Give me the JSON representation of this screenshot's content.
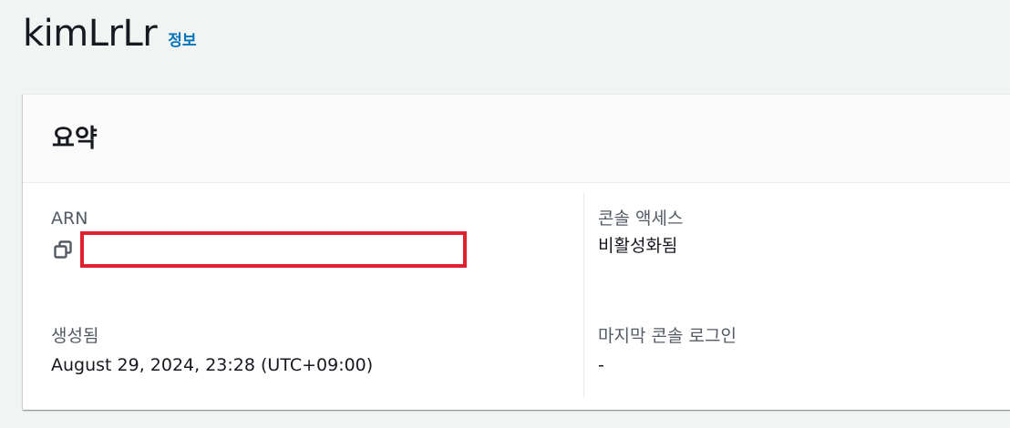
{
  "header": {
    "title": "kimLrLr",
    "info_link": "정보"
  },
  "summary": {
    "title": "요약",
    "arn": {
      "label": "ARN",
      "value": "",
      "copy_icon": "copy-icon",
      "redacted": true,
      "redaction_color": "#e02130"
    },
    "created": {
      "label": "생성됨",
      "value": "August 29, 2024, 23:28 (UTC+09:00)"
    },
    "console_access": {
      "label": "콘솔 액세스",
      "value": "비활성화됨"
    },
    "last_console_login": {
      "label": "마지막 콘솔 로그인",
      "value": "-"
    }
  },
  "colors": {
    "background": "#f2f3f3",
    "link": "#0073bb",
    "label": "#545b64",
    "text": "#16191f"
  }
}
